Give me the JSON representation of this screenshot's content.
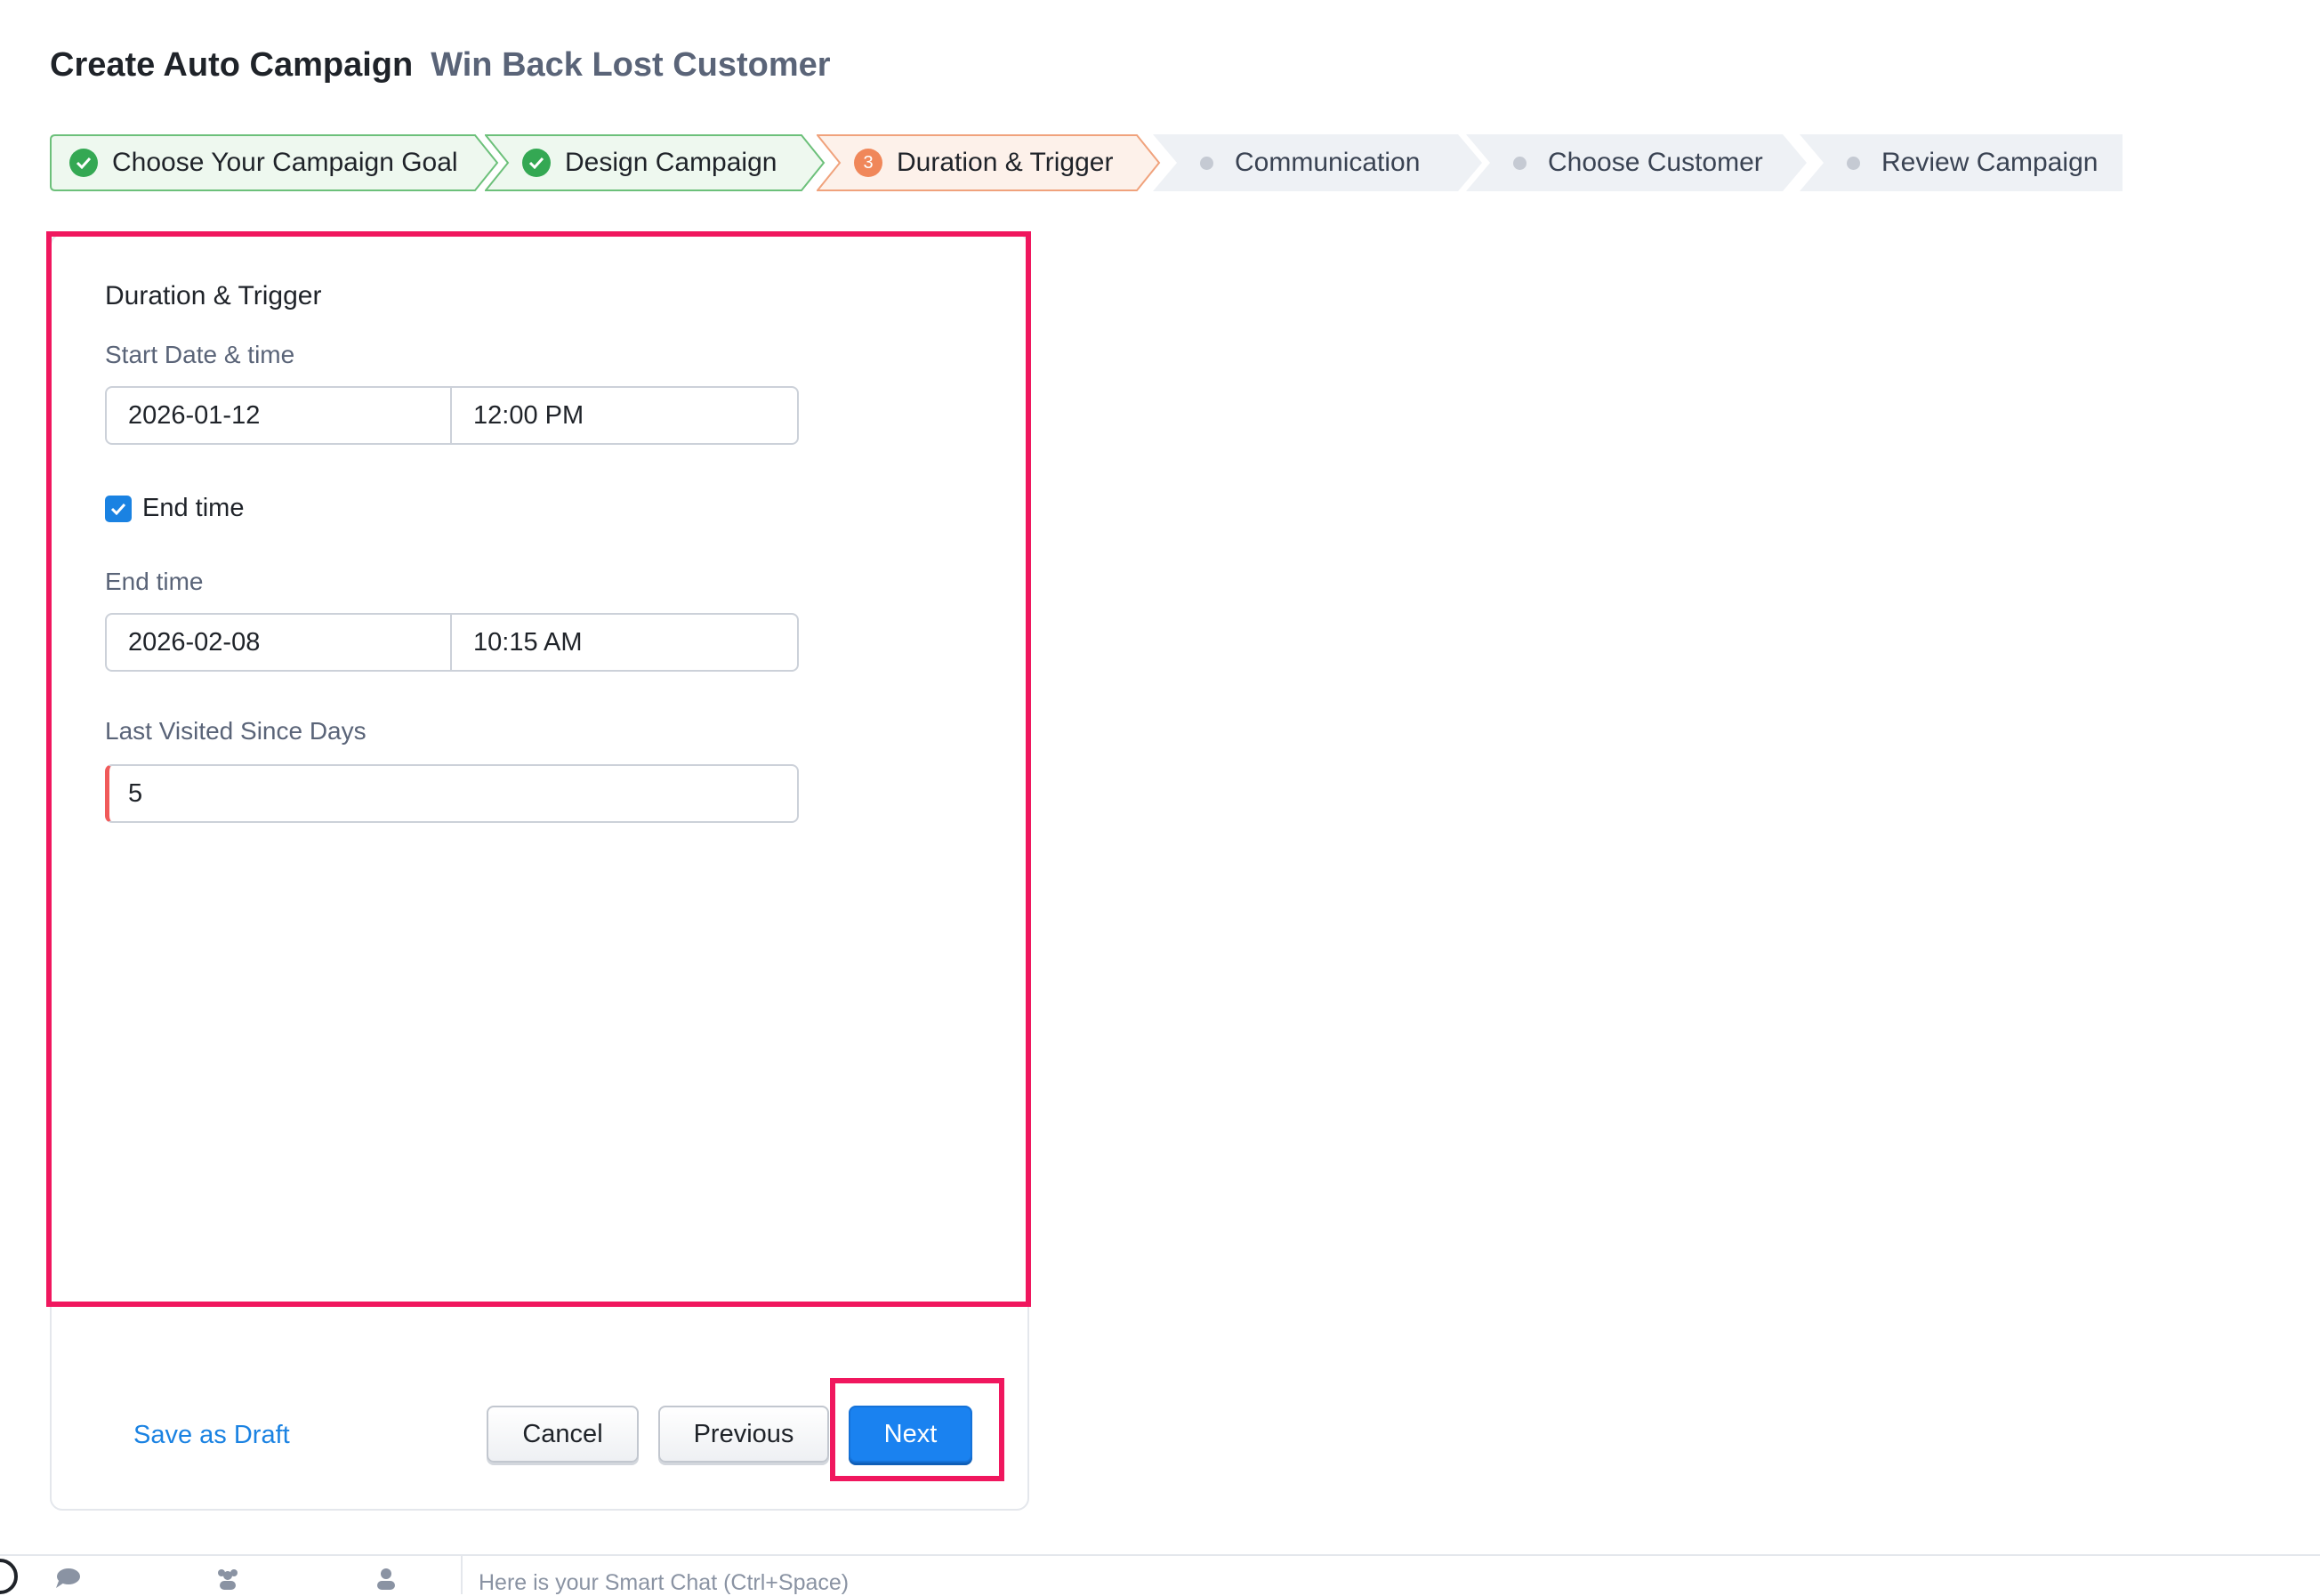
{
  "header": {
    "title": "Create Auto Campaign",
    "subtitle": "Win Back Lost Customer"
  },
  "stepper": {
    "steps": [
      {
        "label": "Choose Your Campaign Goal",
        "status": "done"
      },
      {
        "label": "Design Campaign",
        "status": "done"
      },
      {
        "label": "Duration & Trigger",
        "status": "current",
        "number": "3"
      },
      {
        "label": "Communication",
        "status": "pending"
      },
      {
        "label": "Choose Customer",
        "status": "pending"
      },
      {
        "label": "Review Campaign",
        "status": "pending"
      }
    ]
  },
  "form": {
    "section_title": "Duration & Trigger",
    "start_label": "Start Date & time",
    "start_date": "2026-01-12",
    "start_time": "12:00 PM",
    "end_checkbox_label": "End time",
    "end_checkbox_checked": true,
    "end_label": "End time",
    "end_date": "2026-02-08",
    "end_time": "10:15 AM",
    "days_label": "Last Visited Since Days",
    "days_value": "5"
  },
  "footer": {
    "save_draft": "Save as Draft",
    "cancel": "Cancel",
    "previous": "Previous",
    "next": "Next"
  },
  "bottom_bar": {
    "smart_chat_placeholder": "Here is your Smart Chat (Ctrl+Space)",
    "icons": [
      "chat-icon",
      "channels-icon",
      "contacts-icon"
    ]
  },
  "colors": {
    "done": "#34a853",
    "current": "#f0875a",
    "accent": "#1a82f0",
    "highlight": "#f0175e"
  }
}
